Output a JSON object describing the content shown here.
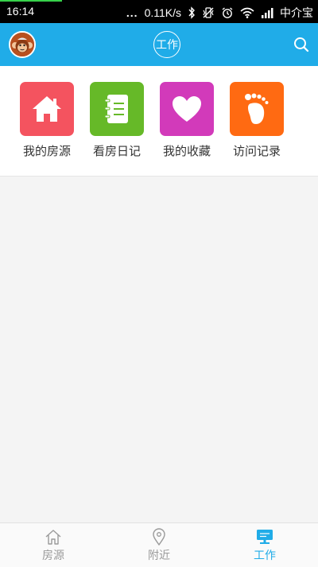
{
  "status_bar": {
    "time": "16:14",
    "dots": "...",
    "speed": "0.11K/s",
    "carrier": "中介宝",
    "icons": [
      "bluetooth-icon",
      "vibrate-icon",
      "alarm-icon",
      "wifi-icon",
      "signal-icon"
    ]
  },
  "header": {
    "title": "工作",
    "avatar_icon": "monkey-avatar",
    "search_icon": "search-icon",
    "bar_color": "#20ace8"
  },
  "quick_actions": [
    {
      "label": "我的房源",
      "icon": "house-icon",
      "color": "#f4535f"
    },
    {
      "label": "看房日记",
      "icon": "notebook-icon",
      "color": "#66b928"
    },
    {
      "label": "我的收藏",
      "icon": "heart-icon",
      "color": "#d23aba"
    },
    {
      "label": "访问记录",
      "icon": "footprint-icon",
      "color": "#ff6a12"
    }
  ],
  "tabs": [
    {
      "label": "房源",
      "icon": "home-outline-icon",
      "active": false
    },
    {
      "label": "附近",
      "icon": "location-pin-icon",
      "active": false
    },
    {
      "label": "工作",
      "icon": "monitor-icon",
      "active": true
    }
  ]
}
